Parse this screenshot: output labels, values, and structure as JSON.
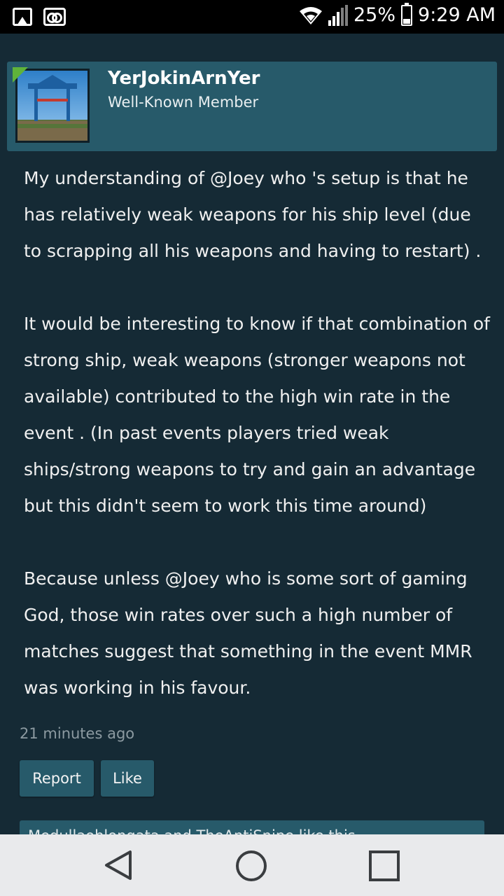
{
  "status_bar": {
    "battery_percent": "25%",
    "time": "9:29 AM",
    "icons": [
      "image-notification-icon",
      "voicemail-icon",
      "wifi-icon",
      "signal-icon",
      "battery-charging-icon"
    ],
    "battery_level": 0.25
  },
  "post": {
    "username": "YerJokinArnYer",
    "user_title": "Well-Known Member",
    "paragraphs": [
      "My understanding of @Joey who 's setup is that he has relatively weak weapons for his ship level (due to scrapping all his weapons and having to restart) .",
      "It would be interesting to know if that combination of strong ship, weak weapons (stronger weapons not available) contributed to the high win rate in the event . (In past events players tried weak ships/strong weapons to try and gain an advantage but this didn't seem to work this time around)",
      "Because unless @Joey who is some sort of gaming God, those win rates over such a high number of matches suggest that something in the event MMR was working in his favour."
    ],
    "timestamp": "21 minutes ago",
    "actions": {
      "report": "Report",
      "like": "Like"
    },
    "likes_summary": "Medullaoblongata and TheAntiSnipe like this."
  },
  "colors": {
    "background": "#152a35",
    "header_panel": "#275a6a",
    "online_indicator": "#5fb33a",
    "nav_bar": "#e9eaec"
  }
}
